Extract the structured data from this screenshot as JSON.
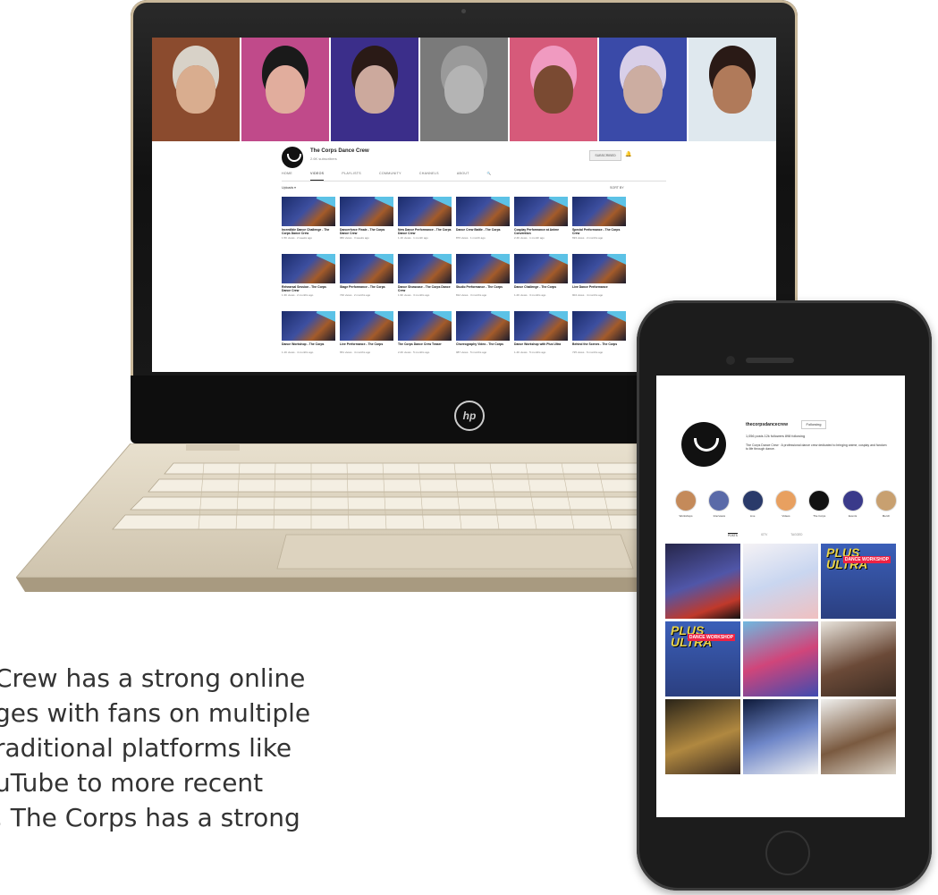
{
  "youtube": {
    "channel_name": "The Corps Dance Crew",
    "subscribers": "2.6K subscribers",
    "subscribe_label": "SUBSCRIBED",
    "tabs": [
      "HOME",
      "VIDEOS",
      "PLAYLISTS",
      "COMMUNITY",
      "CHANNELS",
      "ABOUT"
    ],
    "filter_label": "Uploads ▾",
    "sort_label": "SORT BY",
    "videos": [
      {
        "title": "Incredible Dance Challenge - The Corps Dance Crew",
        "meta": "1.5K views · 2 weeks ago"
      },
      {
        "title": "Dancerforce Finale - The Corps Dance Crew",
        "meta": "982 views · 3 weeks ago"
      },
      {
        "title": "New Dance Performance - The Corps Dance Crew",
        "meta": "1.1K views · 1 month ago"
      },
      {
        "title": "Dance Crew Battle - The Corps",
        "meta": "876 views · 1 month ago"
      },
      {
        "title": "Cosplay Performance at Anime Convention",
        "meta": "2.4K views · 1 month ago"
      },
      {
        "title": "Special Performance - The Corps Crew",
        "meta": "693 views · 2 months ago"
      },
      {
        "title": "Rehearsal Session - The Corps Dance Crew",
        "meta": "1.3K views · 2 months ago"
      },
      {
        "title": "Stage Performance - The Corps",
        "meta": "740 views · 2 months ago"
      },
      {
        "title": "Dance Showcase - The Corps Dance Crew",
        "meta": "1.9K views · 3 months ago"
      },
      {
        "title": "Studio Performance - The Corps",
        "meta": "812 views · 3 months ago"
      },
      {
        "title": "Dance Challenge - The Corps",
        "meta": "1.2K views · 3 months ago"
      },
      {
        "title": "Live Dance Performance",
        "meta": "904 views · 4 months ago"
      },
      {
        "title": "Dance Workshop - The Corps",
        "meta": "1.1K views · 4 months ago"
      },
      {
        "title": "Live Performance - The Corps",
        "meta": "651 views · 4 months ago"
      },
      {
        "title": "The Corps Dance Crew Teaser",
        "meta": "2.2K views · 5 months ago"
      },
      {
        "title": "Choreography Video - The Corps",
        "meta": "987 views · 5 months ago"
      },
      {
        "title": "Dance Workshop with Plus Ultra",
        "meta": "1.4K views · 5 months ago"
      },
      {
        "title": "Behind the Scenes - The Corps",
        "meta": "725 views · 6 months ago"
      }
    ]
  },
  "laptop": {
    "brand_logo": "hp"
  },
  "instagram": {
    "username": "thecorpsdancecrew",
    "follow_label": "Following",
    "stats": "1,056 posts    12k followers    898 following",
    "bio": "The Corps Dance Crew · A professional dance crew dedicated to bringing anime, cosplay and fandom to life through dance.",
    "highlights": [
      "Workshops",
      "Interviews",
      "Live",
      "Videos",
      "The Corps",
      "Events",
      "Merch"
    ],
    "tabs": [
      "POSTS",
      "IGTV",
      "TAGGED"
    ],
    "posts": [
      {
        "overlay_title": "",
        "overlay_sub": ""
      },
      {
        "overlay_title": "",
        "overlay_sub": ""
      },
      {
        "overlay_title": "PLUS ULTRA",
        "overlay_sub": "DANCE WORKSHOP"
      },
      {
        "overlay_title": "PLUS ULTRA",
        "overlay_sub": "DANCE WORKSHOP"
      },
      {
        "overlay_title": "",
        "overlay_sub": ""
      },
      {
        "overlay_title": "",
        "overlay_sub": ""
      },
      {
        "overlay_title": "",
        "overlay_sub": ""
      },
      {
        "overlay_title": "",
        "overlay_sub": ""
      },
      {
        "overlay_title": "",
        "overlay_sub": ""
      }
    ]
  },
  "caption": {
    "lines": [
      "Crew has a strong online",
      "ges with fans on multiple",
      "raditional platforms like",
      "uTube to more recent",
      ", The Corps has a strong"
    ]
  }
}
